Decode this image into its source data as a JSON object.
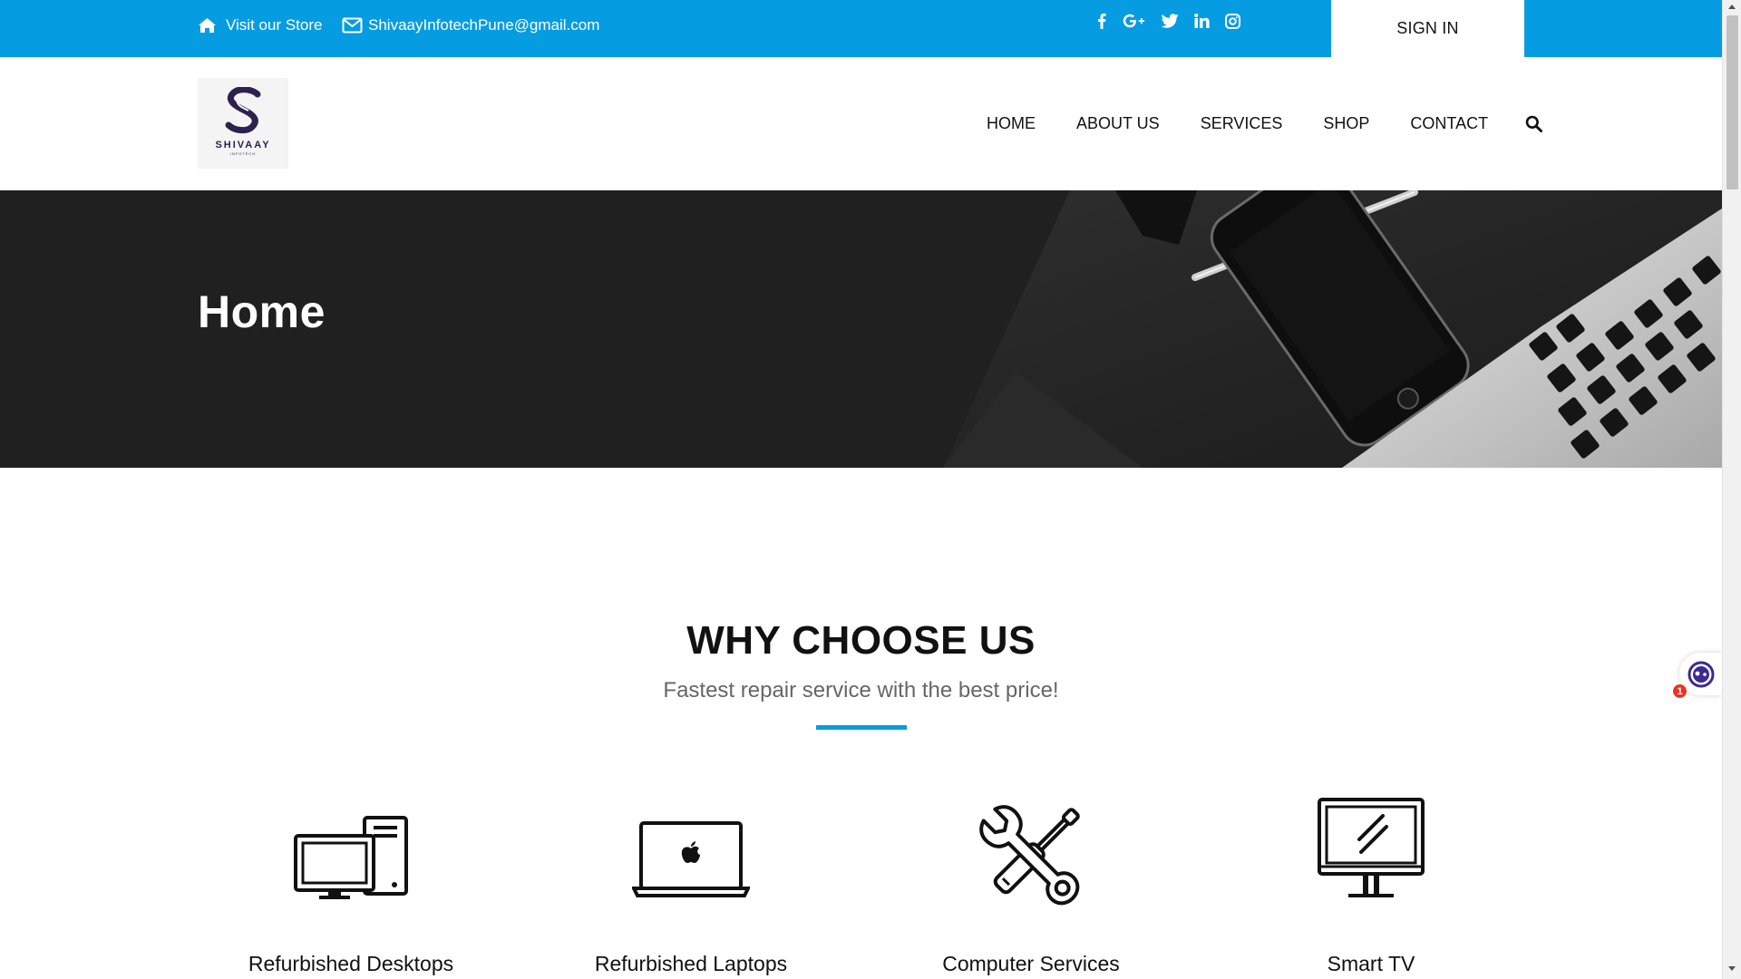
{
  "topbar": {
    "store_label": "Visit our Store",
    "email": "ShivaayInfotechPune@gmail.com",
    "social_icons": [
      "facebook-icon",
      "google-plus-icon",
      "twitter-icon",
      "linkedin-icon",
      "instagram-icon"
    ],
    "sign_in": "SIGN IN",
    "accent_color": "#069ce1"
  },
  "header": {
    "logo_text": "SHIVAAY",
    "logo_subtext": "INFOTECH",
    "nav": [
      "HOME",
      "ABOUT US",
      "SERVICES",
      "SHOP",
      "CONTACT"
    ]
  },
  "hero": {
    "title": "Home"
  },
  "why": {
    "title": "WHY CHOOSE US",
    "subtitle": "Fastest repair service with the best price!",
    "features": [
      {
        "label": "Refurbished Desktops",
        "icon": "desktop-computer-icon"
      },
      {
        "label": "Refurbished Laptops",
        "icon": "laptop-icon"
      },
      {
        "label": "Computer Services",
        "icon": "tools-icon"
      },
      {
        "label": "Smart TV",
        "icon": "monitor-icon"
      }
    ]
  },
  "chat_widget": {
    "badge_count": "1"
  }
}
